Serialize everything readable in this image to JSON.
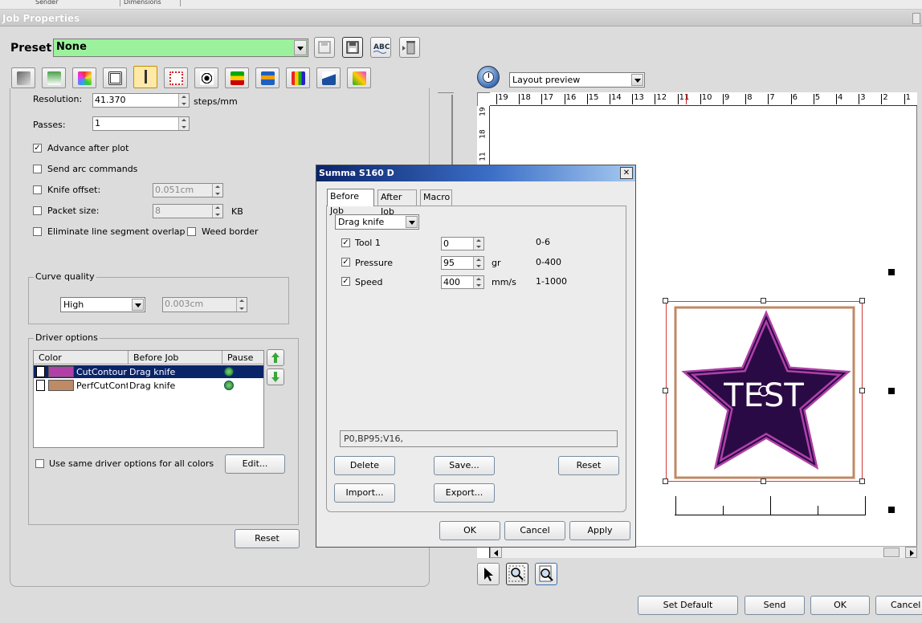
{
  "background_window": {
    "col1": "Sender",
    "col2": "Dimensions"
  },
  "window": {
    "title": "Job Properties"
  },
  "preset": {
    "label": "Preset",
    "value": "None",
    "icons": [
      "save-disabled-icon",
      "save-icon",
      "spellcheck-abc-icon",
      "delete-trash-icon"
    ],
    "abc_text": "ABC"
  },
  "tab_icons": [
    "plotter-icon",
    "media-transfer-icon",
    "color-palette-icon",
    "film-frame-icon",
    "knife-tool-icon",
    "crop-marks-icon",
    "registration-marks-icon",
    "color-bars-icon",
    "layers-icon",
    "color-bars-chart-icon",
    "ink-drop-icon",
    "color-picker-icon"
  ],
  "settings": {
    "resolution": {
      "label": "Resolution:",
      "value": "41.370",
      "unit": "steps/mm"
    },
    "passes": {
      "label": "Passes:",
      "value": "1"
    },
    "advance_after_plot": {
      "label": "Advance after plot",
      "checked": true
    },
    "send_arc": {
      "label": "Send arc commands",
      "checked": false
    },
    "knife_offset": {
      "label": "Knife offset:",
      "checked": false,
      "value": "0.051cm"
    },
    "packet_size": {
      "label": "Packet size:",
      "checked": false,
      "value": "8",
      "unit": "KB"
    },
    "eliminate_overlap": {
      "label": "Eliminate line segment overlap",
      "checked": false
    },
    "weed_border": {
      "label": "Weed border",
      "checked": false
    }
  },
  "curve_quality": {
    "title": "Curve quality",
    "value": "High",
    "tolerance": "0.003cm"
  },
  "driver_options": {
    "title": "Driver options",
    "columns": [
      "Color",
      "Before Job",
      "Pause"
    ],
    "rows": [
      {
        "color": "#b040a8",
        "name": "CutContour",
        "before": "Drag knife",
        "selected": true
      },
      {
        "color": "#bf8a66",
        "name": "PerfCutContour",
        "before": "Drag knife",
        "selected": false
      }
    ],
    "same_for_all": {
      "label": "Use same driver options for all colors",
      "checked": false
    },
    "edit": "Edit...",
    "reset": "Reset"
  },
  "preview": {
    "mode": "Layout preview",
    "ruler_top": [
      "19",
      "18",
      "17",
      "16",
      "15",
      "14",
      "13",
      "12",
      "11",
      "10",
      "9",
      "8",
      "7",
      "6",
      "5",
      "4",
      "3",
      "2",
      "1"
    ],
    "ruler_left": [
      "19",
      "18",
      "11"
    ],
    "artwork_text": "TEST",
    "star_fill": "#2a0a45",
    "star_outline": "#b040a8",
    "perf_border": "#bf8a66",
    "tools": [
      "pointer-tool-icon",
      "zoom-area-icon",
      "zoom-fit-icon"
    ]
  },
  "dialog": {
    "title": "Summa S160 D",
    "close": "✕",
    "tabs": [
      "Before Job",
      "After Job",
      "Macro"
    ],
    "tool_type": "Drag knife",
    "params": [
      {
        "label": "Tool 1",
        "checked": true,
        "value": "0",
        "unit": "",
        "range": "0-6"
      },
      {
        "label": "Pressure",
        "checked": true,
        "value": "95",
        "unit": "gr",
        "range": "0-400"
      },
      {
        "label": "Speed",
        "checked": true,
        "value": "400",
        "unit": "mm/s",
        "range": "1-1000"
      }
    ],
    "command": "P0,BP95;V16,",
    "buttons": {
      "delete": "Delete",
      "save": "Save...",
      "reset": "Reset",
      "import": "Import...",
      "export": "Export...",
      "ok": "OK",
      "cancel": "Cancel",
      "apply": "Apply"
    }
  },
  "footer": {
    "set_default": "Set Default",
    "send": "Send",
    "ok": "OK",
    "cancel": "Cancel"
  }
}
